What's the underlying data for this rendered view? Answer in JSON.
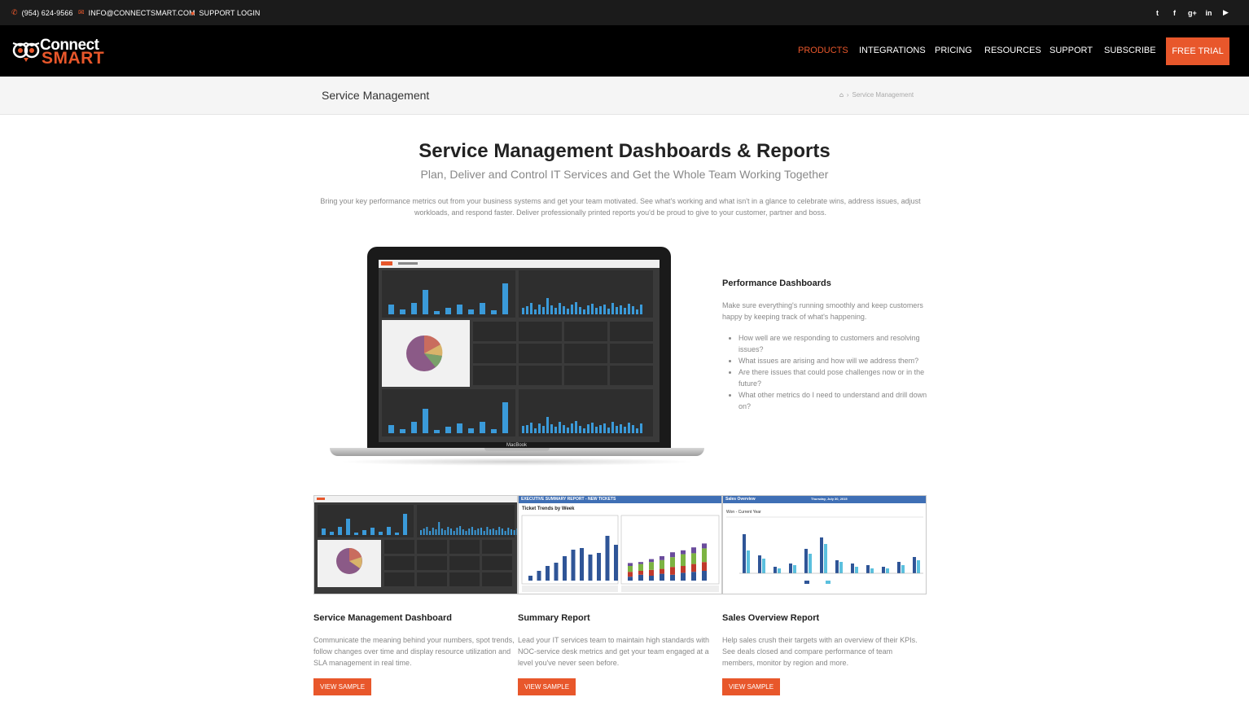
{
  "topbar": {
    "phone": "(954) 624-9566",
    "email": "INFO@CONNECTSMART.COM",
    "login": "SUPPORT LOGIN",
    "social": [
      "twitter-icon",
      "facebook-icon",
      "google-plus-icon",
      "linkedin-icon",
      "youtube-icon"
    ]
  },
  "header": {
    "logo_top": "Connect",
    "logo_bottom": "SMART",
    "nav": [
      "PRODUCTS",
      "INTEGRATIONS",
      "PRICING",
      "RESOURCES",
      "SUPPORT",
      "SUBSCRIBE"
    ],
    "active_nav": "PRODUCTS",
    "cta": "FREE TRIAL",
    "accent": "#e8572b"
  },
  "titlebar": {
    "title": "Service Management",
    "breadcrumb_current": "Service Management"
  },
  "hero": {
    "title": "Service Management Dashboards & Reports",
    "subtitle": "Plan, Deliver and Control IT Services and Get the Whole Team Working Together",
    "text": "Bring your key performance metrics out from your business systems and get your team motivated. See what's working and what isn't in a glance to celebrate wins, address issues, adjust workloads, and respond faster. Deliver professionally printed reports you'd be proud to give to your customer, partner and boss."
  },
  "laptop": {
    "label": "MacBook"
  },
  "performance": {
    "title": "Performance Dashboards",
    "text": "Make sure everything's running smoothly and keep customers happy by keeping track of what's happening.",
    "bullets": [
      "How well are we responding to customers and resolving issues?",
      "What issues are arising and how will we address them?",
      "Are there issues that could pose challenges now or in the future?",
      "What other metrics do I need to understand and drill down on?"
    ]
  },
  "cards": [
    {
      "title": "Service Management Dashboard",
      "text": "Communicate the meaning behind your numbers, spot trends, follow changes over time and display resource utilization and SLA management in real time.",
      "button": "VIEW SAMPLE"
    },
    {
      "title": "Summary Report",
      "text": "Lead your IT services team to maintain high standards with NOC-service desk metrics and get your team engaged at a level you've never seen before.",
      "button": "VIEW SAMPLE",
      "thumb_header": "EXECUTIVE SUMMARY REPORT - NEW TICKETS",
      "thumb_title": "Ticket Trends by Week"
    },
    {
      "title": "Sales Overview Report",
      "text": "Help sales crush their targets with an overview of their KPIs. See deals closed and compare performance of team members, monitor by region and more.",
      "button": "VIEW SAMPLE",
      "thumb_header": "Sales Overview",
      "thumb_date": "Thursday, July 30, 2015",
      "thumb_sub": "Won - Current Year"
    }
  ]
}
